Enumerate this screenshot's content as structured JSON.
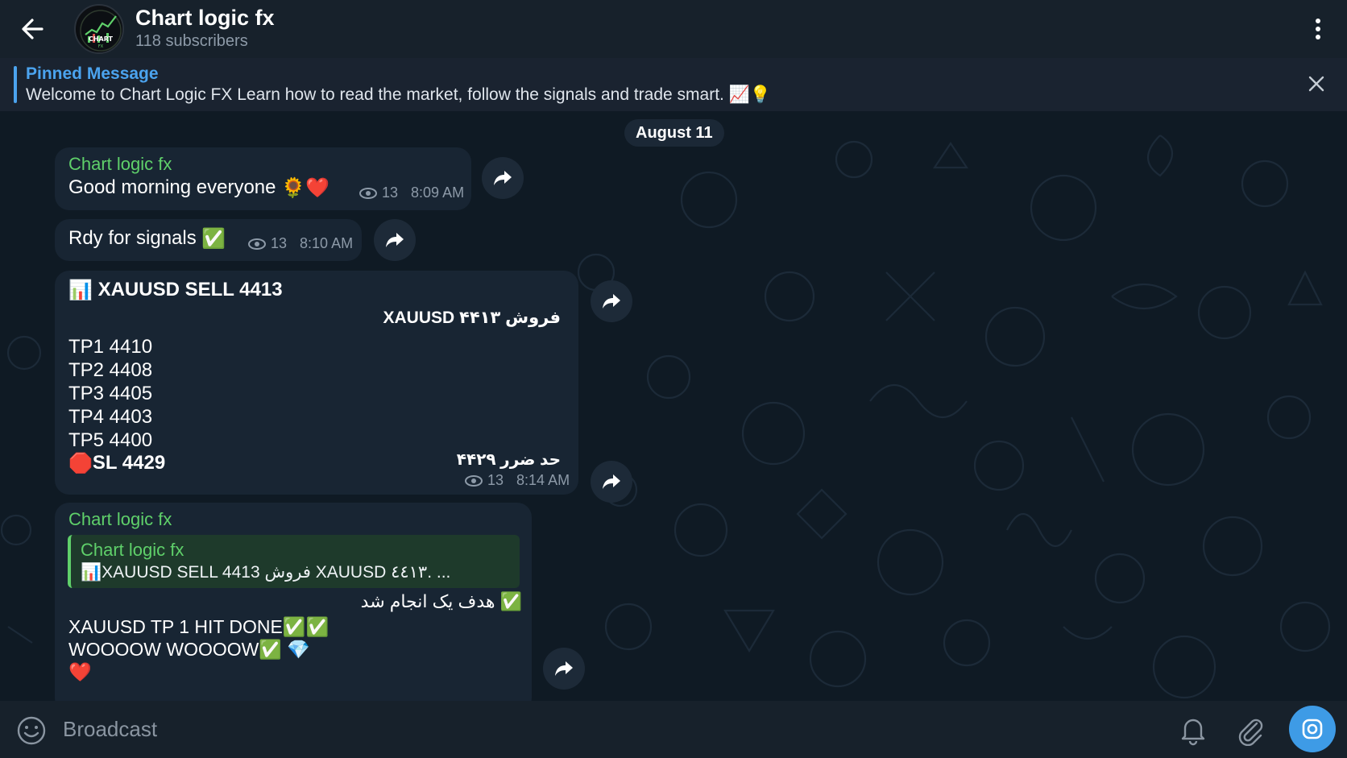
{
  "header": {
    "title": "Chart logic fx",
    "subtitle": "118 subscribers",
    "avatar_text": "CHART FX"
  },
  "pinned": {
    "title": "Pinned Message",
    "text": "Welcome to Chart Logic FX Learn how to read the market, follow the signals and trade smart. 📈💡"
  },
  "date_chip": "August 11",
  "messages": [
    {
      "sender": "Chart logic fx",
      "text": "Good morning everyone",
      "emoji": "🌻❤️",
      "views": "13",
      "time": "8:09 AM"
    },
    {
      "text": "Rdy for signals",
      "emoji": "✅",
      "views": "13",
      "time": "8:10 AM"
    },
    {
      "head_emoji": "📊",
      "title": "XAUUSD SELL 4413",
      "rtl_line": "فروش ۴۴۱۳ XAUUSD",
      "targets": [
        "TP1 4410",
        "TP2 4408",
        "TP3 4405",
        "TP4 4403",
        "TP5 4400"
      ],
      "sl_emoji": "🛑",
      "sl": "SL 4429",
      "rtl_sl": "حد ضرر ۴۴۲۹",
      "views": "13",
      "time": "8:14 AM"
    },
    {
      "sender": "Chart logic fx",
      "quote_sender": "Chart logic fx",
      "quote_text": "📊XAUUSD SELL 4413  فروش  XAUUSD ٤٤١٣.  ...",
      "rtl_line": "✅ هدف یک انجام شد",
      "line1": "XAUUSD TP 1 HIT DONE✅✅",
      "line2": "WOOOOW  WOOOOW✅ 💎",
      "line3": "❤️"
    }
  ],
  "bottom": {
    "placeholder": "Broadcast"
  },
  "colors": {
    "header_bg": "#17212b",
    "chat_bg": "#0f1a24",
    "bubble_bg": "#182533",
    "accent": "#4ba3ee",
    "sender": "#5fd06a"
  }
}
